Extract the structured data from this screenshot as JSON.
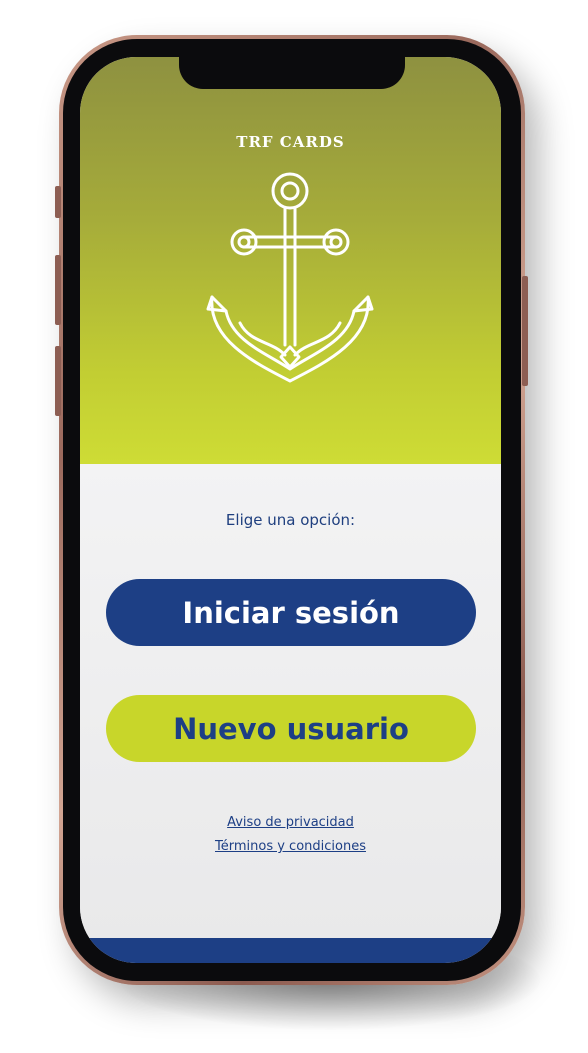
{
  "app": {
    "brand": "TRF CARDS",
    "logo_icon": "anchor-icon"
  },
  "welcome": {
    "prompt": "Elige una opción:",
    "login_label": "Iniciar sesión",
    "signup_label": "Nuevo usuario",
    "privacy_link": "Aviso de privacidad",
    "terms_link": "Términos y condiciones"
  },
  "colors": {
    "primary": "#1d3f85",
    "accent": "#c8d62a",
    "hero_top": "#8e9140",
    "hero_bottom": "#cedc35"
  }
}
